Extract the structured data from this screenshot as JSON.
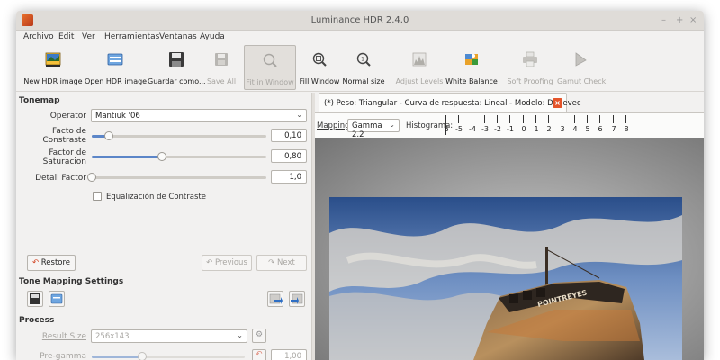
{
  "window": {
    "title": "Luminance HDR 2.4.0",
    "controls": [
      "–",
      "+",
      "×"
    ]
  },
  "menu": [
    "Archivo",
    "Edit",
    "Ver",
    "Herramientas",
    "Ventanas",
    "Ayuda"
  ],
  "toolbar": [
    {
      "id": "new-hdr",
      "label": "New HDR image",
      "icon": "new-hdr-icon",
      "enabled": true
    },
    {
      "id": "open-hdr",
      "label": "Open HDR image",
      "icon": "open-hdr-icon",
      "enabled": true
    },
    {
      "id": "save-as",
      "label": "Guardar como...",
      "icon": "save-icon",
      "enabled": true
    },
    {
      "id": "save-all",
      "label": "Save All",
      "icon": "save-all-icon",
      "enabled": false
    },
    {
      "id": "fit-window",
      "label": "Fit in Window",
      "icon": "zoom-fit-icon",
      "enabled": false,
      "pressed": true
    },
    {
      "id": "fill-window",
      "label": "Fill Window",
      "icon": "zoom-fill-icon",
      "enabled": true
    },
    {
      "id": "normal-size",
      "label": "Normal size",
      "icon": "zoom-original-icon",
      "enabled": true
    },
    {
      "id": "adjust-levels",
      "label": "Adjust Levels",
      "icon": "levels-icon",
      "enabled": false
    },
    {
      "id": "white-balance",
      "label": "White Balance",
      "icon": "white-balance-icon",
      "enabled": true
    },
    {
      "id": "soft-proofing",
      "label": "Soft Proofing",
      "icon": "printer-icon",
      "enabled": false
    },
    {
      "id": "gamut-check",
      "label": "Gamut Check",
      "icon": "gamut-icon",
      "enabled": false
    }
  ],
  "tonemap": {
    "section_title": "Tonemap",
    "operator_label": "Operator",
    "operator_value": "Mantiuk '06",
    "contrast_label_line1": "Facto de",
    "contrast_label_line2": "Constraste",
    "contrast_value": "0,10",
    "contrast_fraction": 0.1,
    "saturation_label_line1": "Factor de",
    "saturation_label_line2": "Saturacion",
    "saturation_value": "0,80",
    "saturation_fraction": 0.4,
    "detail_label": "Detail Factor",
    "detail_value": "1,0",
    "detail_fraction": 0.0,
    "equalization_label": "Equalización de Contraste",
    "equalization_checked": false,
    "restore_label": "Restore",
    "previous_label": "Previous",
    "next_label": "Next"
  },
  "settings": {
    "section_title": "Tone Mapping Settings"
  },
  "process": {
    "section_title": "Process",
    "result_size_label": "Result Size",
    "result_size_value": "256x143",
    "pregamma_label": "Pre-gamma",
    "pregamma_value": "1,00",
    "pregamma_fraction": 0.33
  },
  "tab": {
    "label": "(*) Peso: Triangular - Curva de respuesta: Lineal - Modelo: Debevec",
    "close": "×"
  },
  "mapping": {
    "label": "Mapping:",
    "value": "Gamma 2.2",
    "histogram_label": "Histograma:",
    "ticks": [
      "6",
      "-5",
      "-4",
      "-3",
      "-2",
      "-1",
      "0",
      "1",
      "2",
      "3",
      "4",
      "5",
      "6",
      "7",
      "8"
    ]
  },
  "image": {
    "boat_text": "POINTREYES"
  },
  "colors": {
    "accent": "#5c86c8",
    "close": "#e4542a",
    "window_bg": "#f2f1f0"
  }
}
